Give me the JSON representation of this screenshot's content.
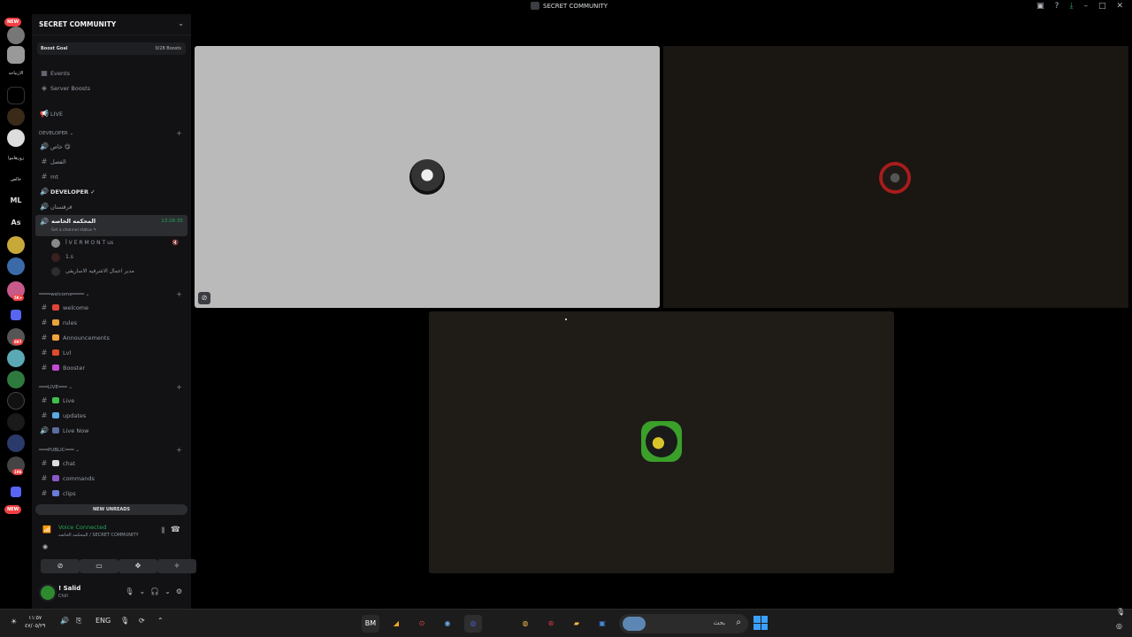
{
  "window": {
    "title": "SECRET COMMUNITY"
  },
  "rail": {
    "new_badge_top": "NEW",
    "new_badge_bottom": "NEW",
    "text_items": [
      "الارتياحه",
      "زوزهاموا",
      "خالص"
    ],
    "ml": "ML",
    "as": "As",
    "counts": [
      "5K+",
      "897",
      "196"
    ]
  },
  "server": {
    "name": "SECRET COMMUNITY",
    "boost_goal": "Boost Goal",
    "boost_count": "0/28 Boosts"
  },
  "top_items": [
    {
      "icon": "calendar-icon",
      "label": "Events"
    },
    {
      "icon": "boost-icon",
      "label": "Server Boosts"
    }
  ],
  "live_channel": "LIVE",
  "categories": {
    "developer": "DEVELOPER",
    "welcome": "welcome",
    "live": "LIVE",
    "public": "PUBLIC"
  },
  "developer_channels": [
    {
      "type": "voice",
      "label": "خاص 😋"
    },
    {
      "type": "text",
      "label": "الفصل"
    },
    {
      "type": "text",
      "label": "mt"
    },
    {
      "type": "voice",
      "label": "DEVELOPER ✓"
    },
    {
      "type": "voice",
      "label": "قرقستان"
    }
  ],
  "active_voice": {
    "name": "المحكمه الخاصه",
    "status": "Set a channel status ✎",
    "time": "13:26:35"
  },
  "voice_users": [
    {
      "name": "ꟾ V E R M O N T us"
    },
    {
      "name": "1.s"
    },
    {
      "name": "مدير اعمال الاشرفيه الاساريفي"
    }
  ],
  "welcome_channels": [
    {
      "label": "welcome",
      "emoji_color": "#e0453a"
    },
    {
      "label": "rules",
      "emoji_color": "#e8a23a"
    },
    {
      "label": "Announcements",
      "emoji_color": "#f0a33c"
    },
    {
      "label": "Lvl",
      "emoji_color": "#e04a2a"
    },
    {
      "label": "Booster",
      "emoji_color": "#c54ad8"
    }
  ],
  "live_channels": [
    {
      "type": "text",
      "label": "Live",
      "emoji_color": "#3ec04a"
    },
    {
      "type": "text",
      "label": "updates",
      "emoji_color": "#5aa9e6"
    },
    {
      "type": "voice",
      "label": "Live Now",
      "emoji_color": "#5a6d9e"
    }
  ],
  "public_channels": [
    {
      "label": "chat",
      "emoji_color": "#dbdee1"
    },
    {
      "label": "commands",
      "emoji_color": "#8a5ac8"
    },
    {
      "label": "clips",
      "emoji_color": "#6a7ad8"
    }
  ],
  "new_unreads": "NEW UNREADS",
  "voice_panel": {
    "status": "Voice Connected",
    "channel": "المحكمه الخاصه / SECRET COMMUNITY"
  },
  "user": {
    "name": "! Salid",
    "status": "Chill"
  },
  "taskbar": {
    "time": "١١:٥٧",
    "date": "٤٧/٠٥/٢٩",
    "lang": "ENG",
    "search_placeholder": "بحث"
  },
  "colors": {
    "accent": "#23a55a",
    "danger": "#f23f43",
    "brand": "#5865f2"
  }
}
